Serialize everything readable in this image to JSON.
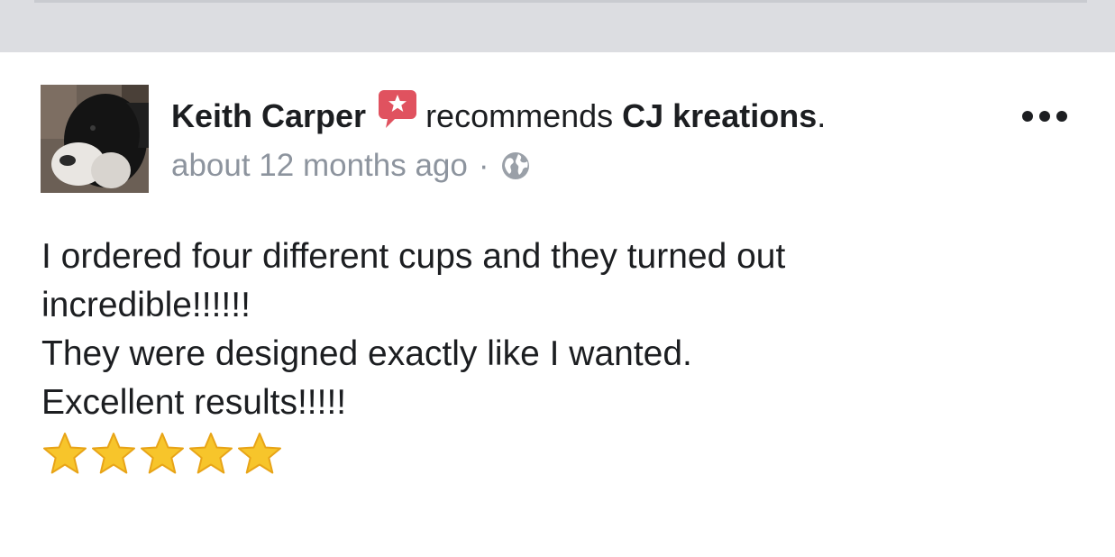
{
  "post": {
    "author_name": "Keith Carper",
    "recommend_verb": "recommends",
    "page_name": "CJ kreations",
    "page_suffix": ".",
    "timestamp": "about 12 months ago",
    "separator": "·",
    "audience_icon": "globe-icon",
    "recommend_icon": "recommendation-star-icon",
    "more_icon": "more-options-icon",
    "body_lines": [
      "I ordered four different cups and they turned out",
      "incredible!!!!!!",
      "They were designed exactly like I wanted.",
      "Excellent results!!!!!"
    ],
    "rating": 5,
    "rating_icon": "star-icon"
  },
  "colors": {
    "top_band": "#dcdde1",
    "text": "#1c1e21",
    "meta_text": "#8d949e",
    "recommend_badge": "#e0525f",
    "star_fill": "#f7c52b",
    "star_stroke": "#e8a417"
  }
}
